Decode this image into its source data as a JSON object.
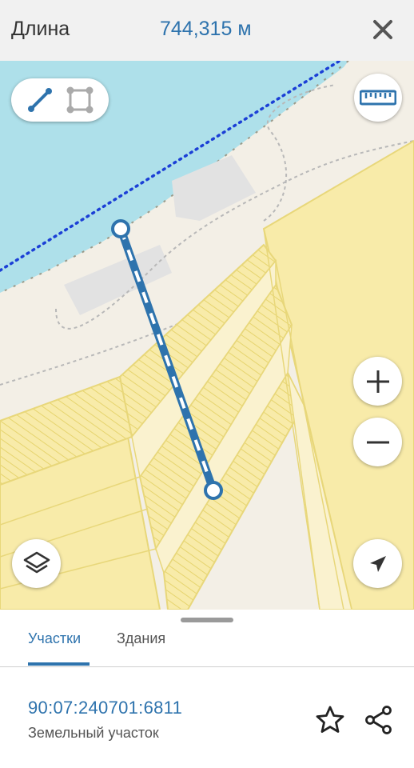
{
  "header": {
    "label": "Длина",
    "value": "744,315 м"
  },
  "tabs": [
    {
      "label": "Участки"
    },
    {
      "label": "Здания"
    }
  ],
  "parcel": {
    "id": "90:07:240701:6811",
    "type": "Земельный участок"
  },
  "colors": {
    "accent": "#2e73ad",
    "water": "#aee0ea",
    "parcel_fill": "#f8eba9",
    "parcel_stroke": "#e8d77a"
  },
  "icons": [
    "close-icon",
    "line-measure-icon",
    "area-measure-icon",
    "ruler-icon",
    "zoom-in-icon",
    "zoom-out-icon",
    "layers-icon",
    "locate-icon",
    "star-icon",
    "share-icon"
  ]
}
